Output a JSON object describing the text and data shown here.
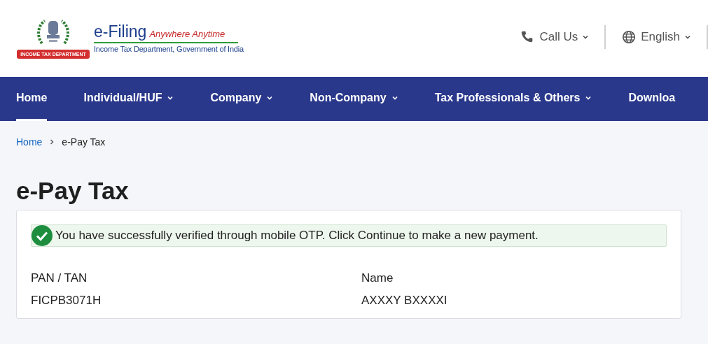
{
  "logo": {
    "ribbon": "INCOME TAX DEPARTMENT",
    "title": "e-Filing",
    "tagline": "Anywhere Anytime",
    "subtitle": "Income Tax Department, Government of India"
  },
  "header_links": [
    {
      "label": "Call Us",
      "kind": "phone"
    },
    {
      "label": "English",
      "kind": "language"
    }
  ],
  "nav": [
    {
      "label": "Home",
      "selected": true,
      "dropdown": false
    },
    {
      "label": "Individual/HUF",
      "selected": false,
      "dropdown": true
    },
    {
      "label": "Company",
      "selected": false,
      "dropdown": true
    },
    {
      "label": "Non-Company",
      "selected": false,
      "dropdown": true
    },
    {
      "label": "Tax Professionals & Others",
      "selected": false,
      "dropdown": true
    },
    {
      "label": "Downloa",
      "selected": false,
      "dropdown": false
    }
  ],
  "breadcrumb": [
    {
      "label": "Home",
      "link": true
    },
    {
      "label": "e-Pay Tax",
      "link": false
    }
  ],
  "page_title": "e-Pay Tax",
  "alert": {
    "text": "You have successfully verified through mobile OTP. Click Continue to make a new payment."
  },
  "fields": [
    {
      "label": "PAN / TAN",
      "value": "FICPB3071H"
    },
    {
      "label": "Name",
      "value": "AXXXY BXXXXI"
    }
  ]
}
